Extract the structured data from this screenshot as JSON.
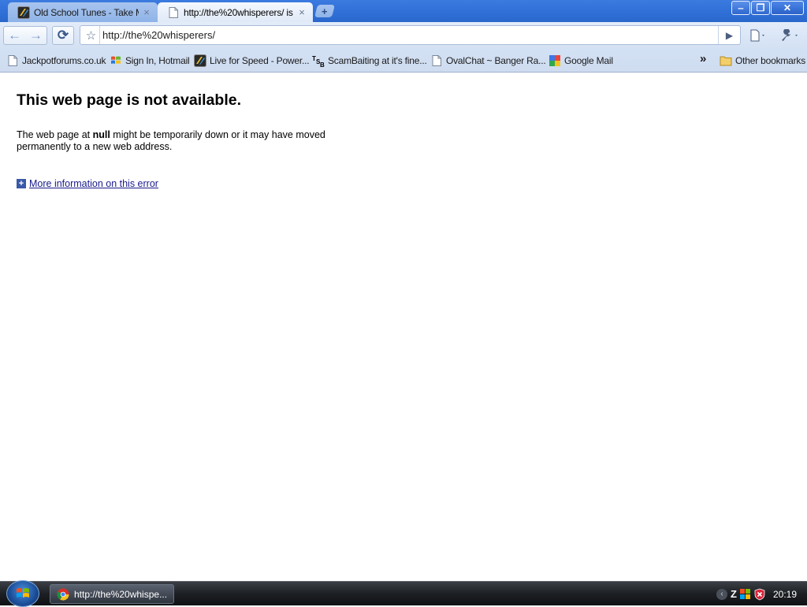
{
  "tabs": [
    {
      "title": "Old School Tunes - Take M...",
      "active": false,
      "icon": "lfs-favicon-icon"
    },
    {
      "title": "http://the%20whisperers/ is ...",
      "active": true,
      "icon": "page-icon"
    }
  ],
  "window_controls": {
    "minimize": "‒",
    "restore": "❐",
    "close": "✕"
  },
  "toolbar": {
    "url": "http://the%20whisperers/",
    "back_label": "←",
    "forward_label": "→",
    "reload_label": "⟳",
    "star_label": "☆",
    "go_label": "▶"
  },
  "bookmarks": [
    {
      "label": "Jackpotforums.co.uk",
      "icon": "page-icon"
    },
    {
      "label": "Sign In, Hotmail",
      "icon": "windows-flag-icon"
    },
    {
      "label": "Live for Speed - Power...",
      "icon": "lfs-favicon-icon"
    },
    {
      "label": "ScamBaiting at it's fine...",
      "icon": "tsb-icon"
    },
    {
      "label": "OvalChat ~ Banger Ra...",
      "icon": "page-icon"
    },
    {
      "label": "Google Mail",
      "icon": "google-icon"
    }
  ],
  "bookmarks_overflow": "»",
  "other_bookmarks": "Other bookmarks",
  "error_page": {
    "title": "This web page is not available.",
    "msg_prefix": "The web page at ",
    "msg_url": "null",
    "msg_suffix": " might be temporarily down or it may have moved permanently to a new web address.",
    "more_info": "More information on this error"
  },
  "taskbar": {
    "window_label": "http://the%20whispe...",
    "clock": "20:19"
  },
  "colors": {
    "titlebar": "#2f6fd6",
    "toolbar": "#d9e5f6",
    "link": "#1a1a8c",
    "taskbar": "#1d2024"
  }
}
